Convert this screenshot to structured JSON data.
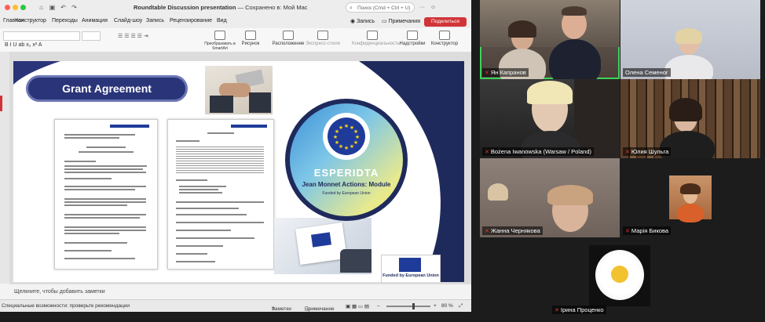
{
  "window": {
    "document_title": "Roundtable Discussion presentation",
    "saved_status": "Сохранено в: Мой Mac",
    "search_placeholder": "Поиск (Cmd + Ctrl + U)",
    "record_label": "Запись",
    "comments_label": "Примечания",
    "share_label": "Поделиться"
  },
  "ribbon_tabs": [
    "Главная",
    "Конструктор",
    "Переходы",
    "Анимация",
    "Слайд-шоу",
    "Запись",
    "Рецензирование",
    "Вид"
  ],
  "ribbon_buttons": [
    "Преобразовать в SmartArt",
    "Рисунок",
    "Расположение",
    "Экспресс-стили",
    "Конфиденциальность",
    "Надстройки",
    "Конструктор"
  ],
  "slide": {
    "heading": "Grant Agreement",
    "logo_name": "ESPERIDTA",
    "logo_subtitle": "Jean Monnet Actions: Module",
    "logo_funded": "Funded by European Union",
    "badge_text": "Funded by European Union"
  },
  "notes_placeholder": "Щелкните, чтобы добавить заметки",
  "status_bar": {
    "accessibility": "Специальные возможности: проверьте рекомендации",
    "notes": "Заметки",
    "comments": "Примечание",
    "zoom": "80 %"
  },
  "participants": [
    {
      "name": "Ян Капранов",
      "muted": true,
      "active": true
    },
    {
      "name": "Олена Семеног",
      "muted": false,
      "active": false
    },
    {
      "name": "Bożena Iwanowska (Warsaw / Poland)",
      "muted": true,
      "active": false
    },
    {
      "name": "Юлия Шульга",
      "muted": true,
      "active": false
    },
    {
      "name": "Жанна Чернякова",
      "muted": true,
      "active": false
    },
    {
      "name": "Марія Бикова",
      "muted": true,
      "active": false
    },
    {
      "name": "Ірина Проценко",
      "muted": true,
      "active": false
    }
  ],
  "colors": {
    "accent_navy": "#2a3478",
    "active_speaker": "#3ed35b",
    "share_button": "#d13438"
  }
}
